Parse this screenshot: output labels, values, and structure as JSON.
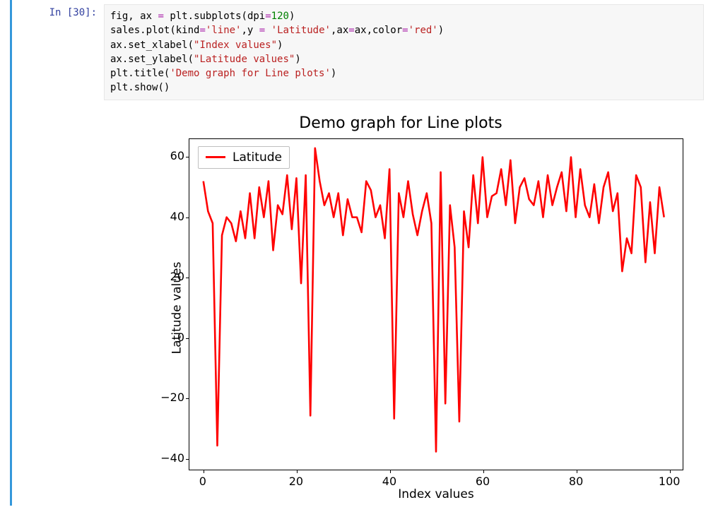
{
  "cell": {
    "prompt": "In [30]:",
    "code_tokens": [
      [
        [
          "name",
          "fig"
        ],
        [
          "op",
          ", "
        ],
        [
          "name",
          "ax"
        ],
        [
          "op",
          " "
        ],
        [
          "eq",
          "="
        ],
        [
          "op",
          " "
        ],
        [
          "name",
          "plt"
        ],
        [
          "op",
          "."
        ],
        [
          "call",
          "subplots"
        ],
        [
          "paren",
          "("
        ],
        [
          "argname",
          "dpi"
        ],
        [
          "eq",
          "="
        ],
        [
          "num",
          "120"
        ],
        [
          "paren",
          ")"
        ]
      ],
      [
        [
          "name",
          "sales"
        ],
        [
          "op",
          "."
        ],
        [
          "call",
          "plot"
        ],
        [
          "paren",
          "("
        ],
        [
          "argname",
          "kind"
        ],
        [
          "eq",
          "="
        ],
        [
          "str",
          "'line'"
        ],
        [
          "op",
          ","
        ],
        [
          "argname",
          "y"
        ],
        [
          "op",
          " "
        ],
        [
          "eq",
          "="
        ],
        [
          "op",
          " "
        ],
        [
          "str",
          "'Latitude'"
        ],
        [
          "op",
          ","
        ],
        [
          "argname",
          "ax"
        ],
        [
          "eq",
          "="
        ],
        [
          "name",
          "ax"
        ],
        [
          "op",
          ","
        ],
        [
          "argname",
          "color"
        ],
        [
          "eq",
          "="
        ],
        [
          "str",
          "'red'"
        ],
        [
          "paren",
          ")"
        ]
      ],
      [
        [
          "name",
          "ax"
        ],
        [
          "op",
          "."
        ],
        [
          "call",
          "set_xlabel"
        ],
        [
          "paren",
          "("
        ],
        [
          "str",
          "\"Index values\""
        ],
        [
          "paren",
          ")"
        ]
      ],
      [
        [
          "name",
          "ax"
        ],
        [
          "op",
          "."
        ],
        [
          "call",
          "set_ylabel"
        ],
        [
          "paren",
          "("
        ],
        [
          "str",
          "\"Latitude values\""
        ],
        [
          "paren",
          ")"
        ]
      ],
      [
        [
          "name",
          "plt"
        ],
        [
          "op",
          "."
        ],
        [
          "call",
          "title"
        ],
        [
          "paren",
          "("
        ],
        [
          "str",
          "'Demo graph for Line plots'"
        ],
        [
          "paren",
          ")"
        ]
      ],
      [
        [
          "name",
          "plt"
        ],
        [
          "op",
          "."
        ],
        [
          "call",
          "show"
        ],
        [
          "paren",
          "("
        ],
        [
          "paren",
          ")"
        ]
      ]
    ]
  },
  "chart_data": {
    "type": "line",
    "title": "Demo graph for Line plots",
    "xlabel": "Index values",
    "ylabel": "Latitude values",
    "legend": [
      "Latitude"
    ],
    "line_color": "red",
    "xlim": [
      -3,
      103
    ],
    "ylim": [
      -44,
      66
    ],
    "xticks": [
      0,
      20,
      40,
      60,
      80,
      100
    ],
    "yticks": [
      -40,
      -20,
      0,
      20,
      40,
      60
    ],
    "x": [
      0,
      1,
      2,
      3,
      4,
      5,
      6,
      7,
      8,
      9,
      10,
      11,
      12,
      13,
      14,
      15,
      16,
      17,
      18,
      19,
      20,
      21,
      22,
      23,
      24,
      25,
      26,
      27,
      28,
      29,
      30,
      31,
      32,
      33,
      34,
      35,
      36,
      37,
      38,
      39,
      40,
      41,
      42,
      43,
      44,
      45,
      46,
      47,
      48,
      49,
      50,
      51,
      52,
      53,
      54,
      55,
      56,
      57,
      58,
      59,
      60,
      61,
      62,
      63,
      64,
      65,
      66,
      67,
      68,
      69,
      70,
      71,
      72,
      73,
      74,
      75,
      76,
      77,
      78,
      79,
      80,
      81,
      82,
      83,
      84,
      85,
      86,
      87,
      88,
      89,
      90,
      91,
      92,
      93,
      94,
      95,
      96,
      97,
      98,
      99
    ],
    "values": [
      52,
      42,
      38,
      -36,
      34,
      40,
      38,
      32,
      42,
      33,
      48,
      33,
      50,
      40,
      52,
      29,
      44,
      41,
      54,
      36,
      53,
      18,
      54,
      -26,
      63,
      52,
      44,
      48,
      40,
      48,
      34,
      46,
      40,
      40,
      35,
      52,
      49,
      40,
      44,
      33,
      56,
      -27,
      48,
      40,
      52,
      41,
      34,
      42,
      48,
      38,
      -38,
      55,
      -22,
      44,
      30,
      -28,
      42,
      30,
      54,
      38,
      60,
      40,
      47,
      48,
      56,
      44,
      59,
      38,
      50,
      53,
      46,
      44,
      52,
      40,
      54,
      44,
      50,
      55,
      42,
      60,
      40,
      56,
      44,
      40,
      51,
      38,
      50,
      55,
      42,
      48,
      22,
      33,
      28,
      54,
      50,
      25,
      45,
      28,
      50,
      40
    ]
  }
}
